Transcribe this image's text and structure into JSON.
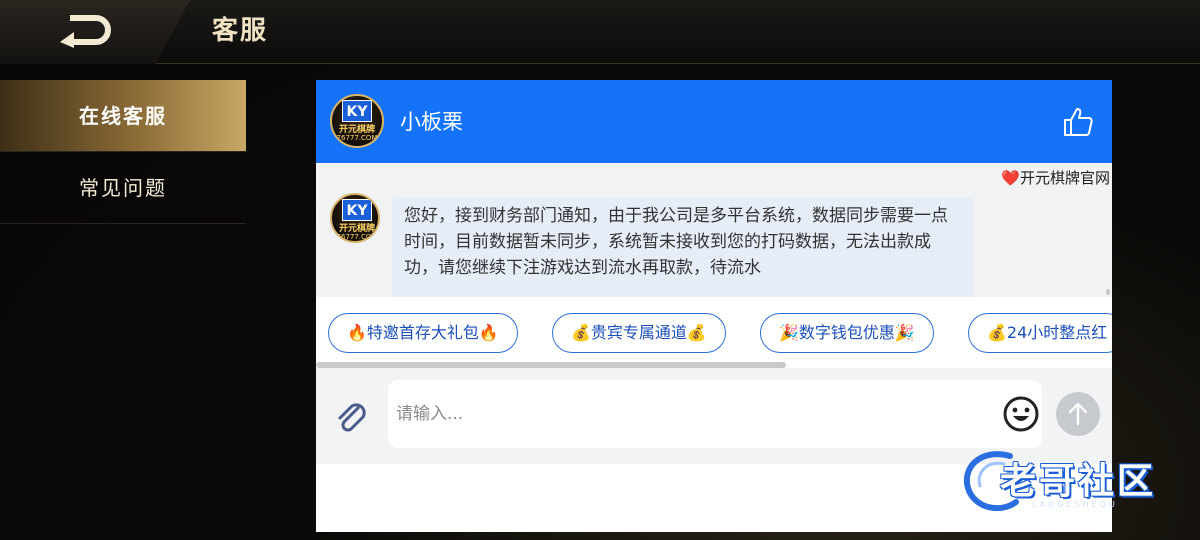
{
  "header": {
    "title": "客服",
    "back_icon": "back-arrow-icon"
  },
  "sidebar": {
    "items": [
      {
        "label": "在线客服",
        "active": true
      },
      {
        "label": "常见问题",
        "active": false
      }
    ]
  },
  "chat": {
    "agent_name": "小板栗",
    "avatar": {
      "badge": "KY",
      "brand": "开元棋牌",
      "url": "76777.COM"
    },
    "site_link": "❤️开元棋牌官网",
    "message": "您好，接到财务部门通知，由于我公司是多平台系统，数据同步需要一点时间，目前数据暂未同步，系统暂未接收到您的打码数据，无法出款成功，请您继续下注游戏达到流水再取款，待流水",
    "quick_replies": [
      "🔥特邀首存大礼包🔥",
      "💰贵宾专属通道💰",
      "🎉数字钱包优惠🎉",
      "💰24小时整点红"
    ],
    "input": {
      "placeholder": "请输入...",
      "value": ""
    }
  },
  "watermark": {
    "text": "老哥社区",
    "sub": "LAOGESHEQU"
  },
  "colors": {
    "header_blue": "#1473fa",
    "chip_border": "#2b6fd6",
    "gold": "#c9a765"
  }
}
